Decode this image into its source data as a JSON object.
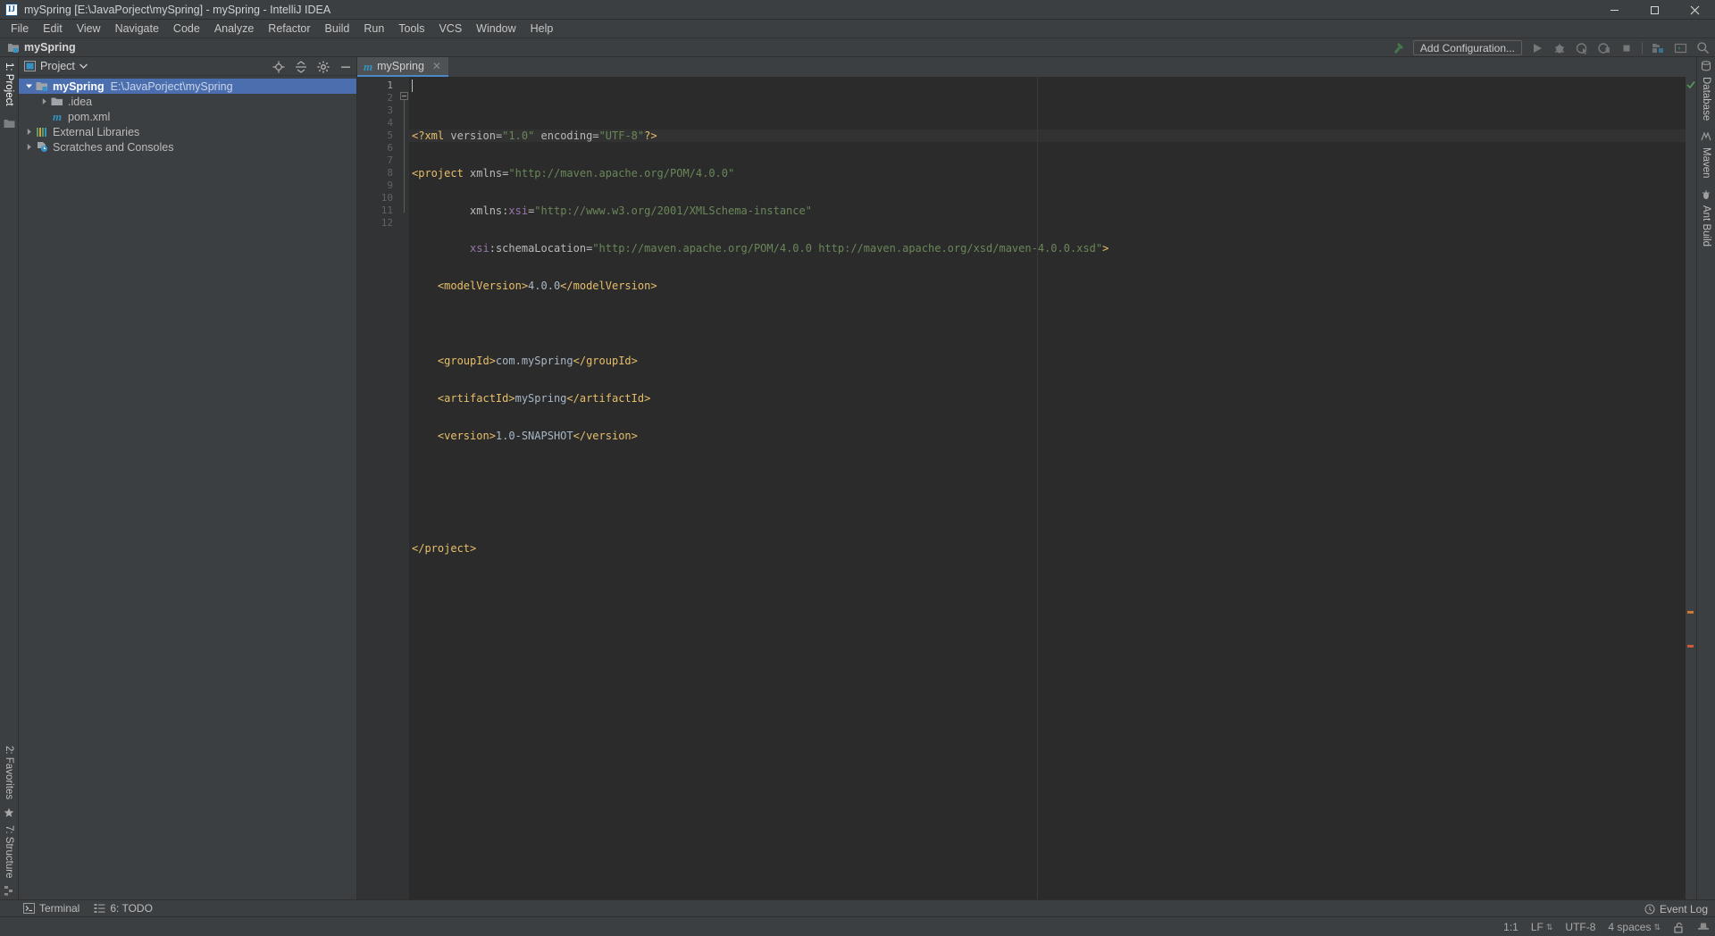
{
  "window": {
    "title": "mySpring [E:\\JavaPorject\\mySpring] - mySpring - IntelliJ IDEA",
    "logo_text": "IJ",
    "minimize_label": "Minimize",
    "maximize_label": "Maximize",
    "close_label": "Close"
  },
  "menubar": {
    "items": [
      {
        "label": "File"
      },
      {
        "label": "Edit"
      },
      {
        "label": "View"
      },
      {
        "label": "Navigate"
      },
      {
        "label": "Code"
      },
      {
        "label": "Analyze"
      },
      {
        "label": "Refactor"
      },
      {
        "label": "Build"
      },
      {
        "label": "Run"
      },
      {
        "label": "Tools"
      },
      {
        "label": "VCS"
      },
      {
        "label": "Window"
      },
      {
        "label": "Help"
      }
    ]
  },
  "navbar": {
    "breadcrumb": "mySpring",
    "add_configuration_label": "Add Configuration...",
    "icons": [
      "hammer-build-icon",
      "run-icon",
      "debug-icon",
      "run-coverage-icon",
      "profile-icon",
      "stop-icon",
      "project-structure-icon",
      "console-icon",
      "search-everywhere-icon"
    ]
  },
  "left_strip": {
    "top_label": "1: Project",
    "bottom_labels": [
      "2: Favorites",
      "7: Structure"
    ]
  },
  "right_strip": {
    "labels": [
      "Database",
      "Maven",
      "Ant Build"
    ]
  },
  "project_panel": {
    "title": "Project",
    "dropdown_icon": "chevron-down-icon",
    "actions": [
      "locate-icon",
      "collapse-all-icon",
      "settings-gear-icon",
      "hide-icon"
    ],
    "tree": [
      {
        "depth": 0,
        "label": "mySpring",
        "sub": "E:\\JavaPorject\\mySpring",
        "icon": "module-folder-icon",
        "arrow": "expanded",
        "selected": true,
        "bold": true
      },
      {
        "depth": 1,
        "label": ".idea",
        "sub": "",
        "icon": "folder-icon",
        "arrow": "collapsed",
        "selected": false,
        "bold": false
      },
      {
        "depth": 1,
        "label": "pom.xml",
        "sub": "",
        "icon": "maven-file-icon",
        "arrow": "none",
        "selected": false,
        "bold": false
      },
      {
        "depth": 0,
        "label": "External Libraries",
        "sub": "",
        "icon": "libraries-icon",
        "arrow": "collapsed",
        "selected": false,
        "bold": false
      },
      {
        "depth": 0,
        "label": "Scratches and Consoles",
        "sub": "",
        "icon": "scratches-icon",
        "arrow": "collapsed",
        "selected": false,
        "bold": false
      }
    ]
  },
  "editor": {
    "tab": {
      "label": "mySpring",
      "icon": "maven-file-icon",
      "close_icon": "close-icon"
    },
    "inspection_status": "ok-checkmark-icon",
    "line_numbers": [
      "1",
      "2",
      "3",
      "4",
      "5",
      "6",
      "7",
      "8",
      "9",
      "10",
      "11",
      "12"
    ],
    "lines": [
      {
        "n": 1,
        "segments": [
          {
            "t": "<?xml ",
            "c": "tok-pi"
          },
          {
            "t": "version",
            "c": "tok-attr"
          },
          {
            "t": "=",
            "c": "tok-attr"
          },
          {
            "t": "\"1.0\"",
            "c": "tok-val"
          },
          {
            "t": " ",
            "c": "tok-attr"
          },
          {
            "t": "encoding",
            "c": "tok-attr"
          },
          {
            "t": "=",
            "c": "tok-attr"
          },
          {
            "t": "\"UTF-8\"",
            "c": "tok-val"
          },
          {
            "t": "?>",
            "c": "tok-pi"
          }
        ]
      },
      {
        "n": 2,
        "segments": [
          {
            "t": "<project",
            "c": "tok-tag"
          },
          {
            "t": " xmlns",
            "c": "tok-attr"
          },
          {
            "t": "=",
            "c": "tok-attr"
          },
          {
            "t": "\"http://maven.apache.org/POM/4.0.0\"",
            "c": "tok-val"
          }
        ]
      },
      {
        "n": 3,
        "segments": [
          {
            "t": "         xmlns:",
            "c": "tok-attr"
          },
          {
            "t": "xsi",
            "c": "tok-ns"
          },
          {
            "t": "=",
            "c": "tok-attr"
          },
          {
            "t": "\"http://www.w3.org/2001/XMLSchema-instance\"",
            "c": "tok-val"
          }
        ]
      },
      {
        "n": 4,
        "segments": [
          {
            "t": "         ",
            "c": "tok-attr"
          },
          {
            "t": "xsi",
            "c": "tok-ns"
          },
          {
            "t": ":schemaLocation",
            "c": "tok-attr"
          },
          {
            "t": "=",
            "c": "tok-attr"
          },
          {
            "t": "\"http://maven.apache.org/POM/4.0.0 http://maven.apache.org/xsd/maven-4.0.0.xsd\"",
            "c": "tok-val"
          },
          {
            "t": ">",
            "c": "tok-tag"
          }
        ]
      },
      {
        "n": 5,
        "segments": [
          {
            "t": "    <modelVersion>",
            "c": "tok-tag"
          },
          {
            "t": "4.0.0",
            "c": "tok-txt"
          },
          {
            "t": "</modelVersion>",
            "c": "tok-tag"
          }
        ]
      },
      {
        "n": 6,
        "segments": [
          {
            "t": "",
            "c": "tok-txt"
          }
        ]
      },
      {
        "n": 7,
        "segments": [
          {
            "t": "    <groupId>",
            "c": "tok-tag"
          },
          {
            "t": "com.mySpring",
            "c": "tok-txt"
          },
          {
            "t": "</groupId>",
            "c": "tok-tag"
          }
        ]
      },
      {
        "n": 8,
        "segments": [
          {
            "t": "    <artifactId>",
            "c": "tok-tag"
          },
          {
            "t": "mySpring",
            "c": "tok-txt"
          },
          {
            "t": "</artifactId>",
            "c": "tok-tag"
          }
        ]
      },
      {
        "n": 9,
        "segments": [
          {
            "t": "    <version>",
            "c": "tok-tag"
          },
          {
            "t": "1.0-SNAPSHOT",
            "c": "tok-txt"
          },
          {
            "t": "</version>",
            "c": "tok-tag"
          }
        ]
      },
      {
        "n": 10,
        "segments": [
          {
            "t": "",
            "c": "tok-txt"
          }
        ]
      },
      {
        "n": 11,
        "segments": [
          {
            "t": "",
            "c": "tok-txt"
          }
        ]
      },
      {
        "n": 12,
        "segments": [
          {
            "t": "</project>",
            "c": "tok-tag"
          }
        ]
      }
    ]
  },
  "bottom_bar": {
    "items": [
      {
        "label": "Terminal",
        "icon": "terminal-icon"
      },
      {
        "label": "6: TODO",
        "icon": "todo-icon"
      }
    ],
    "event_log": {
      "label": "Event Log",
      "icon": "event-log-icon"
    }
  },
  "status_bar": {
    "caret_position": "1:1",
    "line_separator": "LF",
    "encoding": "UTF-8",
    "indent": "4 spaces",
    "lock_icon": "unlocked-icon",
    "inspection_icon": "inspector-hat-icon"
  },
  "colors": {
    "accent_blue": "#4b6eaf",
    "tab_underline": "#4a88c7",
    "panel_bg": "#3c3f41",
    "editor_bg": "#2b2b2b",
    "gutter_bg": "#313335",
    "tag_color": "#e8bf6a",
    "string_color": "#6a8759",
    "ns_color": "#9876aa",
    "ok_green": "#599e5e"
  }
}
